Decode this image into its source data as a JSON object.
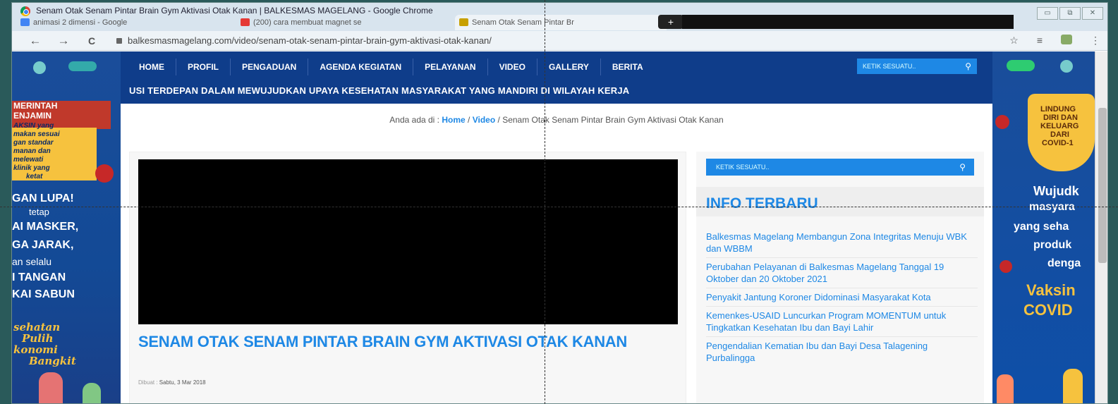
{
  "window": {
    "title": "Senam Otak Senam Pintar Brain Gym Aktivasi Otak Kanan | BALKESMAS MAGELANG - Google Chrome",
    "tabs": [
      {
        "label": "animasi 2 dimensi - Google"
      },
      {
        "label": "(200) cara membuat magnet se"
      },
      {
        "label": "Senam Otak Senam Pintar Br"
      }
    ],
    "newtab": "+",
    "controls": [
      "▭",
      "⧉",
      "✕"
    ]
  },
  "toolbar": {
    "back": "←",
    "forward": "→",
    "reload": "C",
    "url": "balkesmasmagelang.com/video/senam-otak-senam-pintar-brain-gym-aktivasi-otak-kanan/",
    "star": "☆",
    "ext": "≡",
    "menu": "⋮"
  },
  "site": {
    "menu": [
      "HOME",
      "PROFIL",
      "PENGADUAN",
      "AGENDA KEGIATAN",
      "PELAYANAN",
      "VIDEO",
      "GALLERY",
      "BERITA"
    ],
    "header_search_placeholder": "KETIK SESUATU..",
    "ticker": "USI TERDEPAN DALAM MEWUJUDKAN UPAYA KESEHATAN MASYARAKAT YANG MANDIRI DI WILAYAH KERJA",
    "breadcrumb": {
      "prefix": "Anda ada di : ",
      "home": "Home",
      "sep": " / ",
      "video": "Video",
      "current": "Senam Otak Senam Pintar Brain Gym Aktivasi Otak Kanan"
    },
    "post": {
      "title": "SENAM OTAK SENAM PINTAR BRAIN GYM AKTIVASI OTAK KANAN",
      "date_label": "Dibuat : ",
      "date": "Sabtu, 3 Mar 2018"
    },
    "sidebar": {
      "search_placeholder": "KETIK SESUATU..",
      "heading": "INFO TERBARU",
      "news": [
        "Balkesmas Magelang Membangun Zona Integritas Menuju WBK dan WBBM",
        "Perubahan Pelayanan di Balkesmas Magelang Tanggal 19 Oktober dan 20 Oktober 2021",
        "Penyakit Jantung Koroner Didominasi Masyarakat Kota",
        "Kemenkes-USAID Luncurkan Program MOMENTUM untuk Tingkatkan Kesehatan Ibu dan Bayi Lahir",
        "Pengendalian Kematian Ibu dan Bayi Desa Talagening Purbalingga"
      ]
    },
    "left_ad": {
      "lines": [
        "MERINTAH",
        "ENJAMIN",
        "AKSIN yang",
        "makan sesuai",
        "gan standar",
        "manan dan",
        "melewati",
        "klinik yang",
        "ketat",
        "GAN LUPA!",
        "tetap",
        "AI MASKER,",
        "GA JARAK,",
        "an selalu",
        "I TANGAN",
        "KAI SABUN",
        "sehatan",
        "Pulih",
        "konomi",
        "Bangkit"
      ]
    },
    "right_ad": {
      "lines": [
        "LINDUNG",
        "DIRI DAN",
        "KELUARG",
        "DARI",
        "COVID-1",
        "Wujudk",
        "masyara",
        "yang seha",
        "produk",
        "denga",
        "Vaksin",
        "COVID"
      ]
    }
  }
}
